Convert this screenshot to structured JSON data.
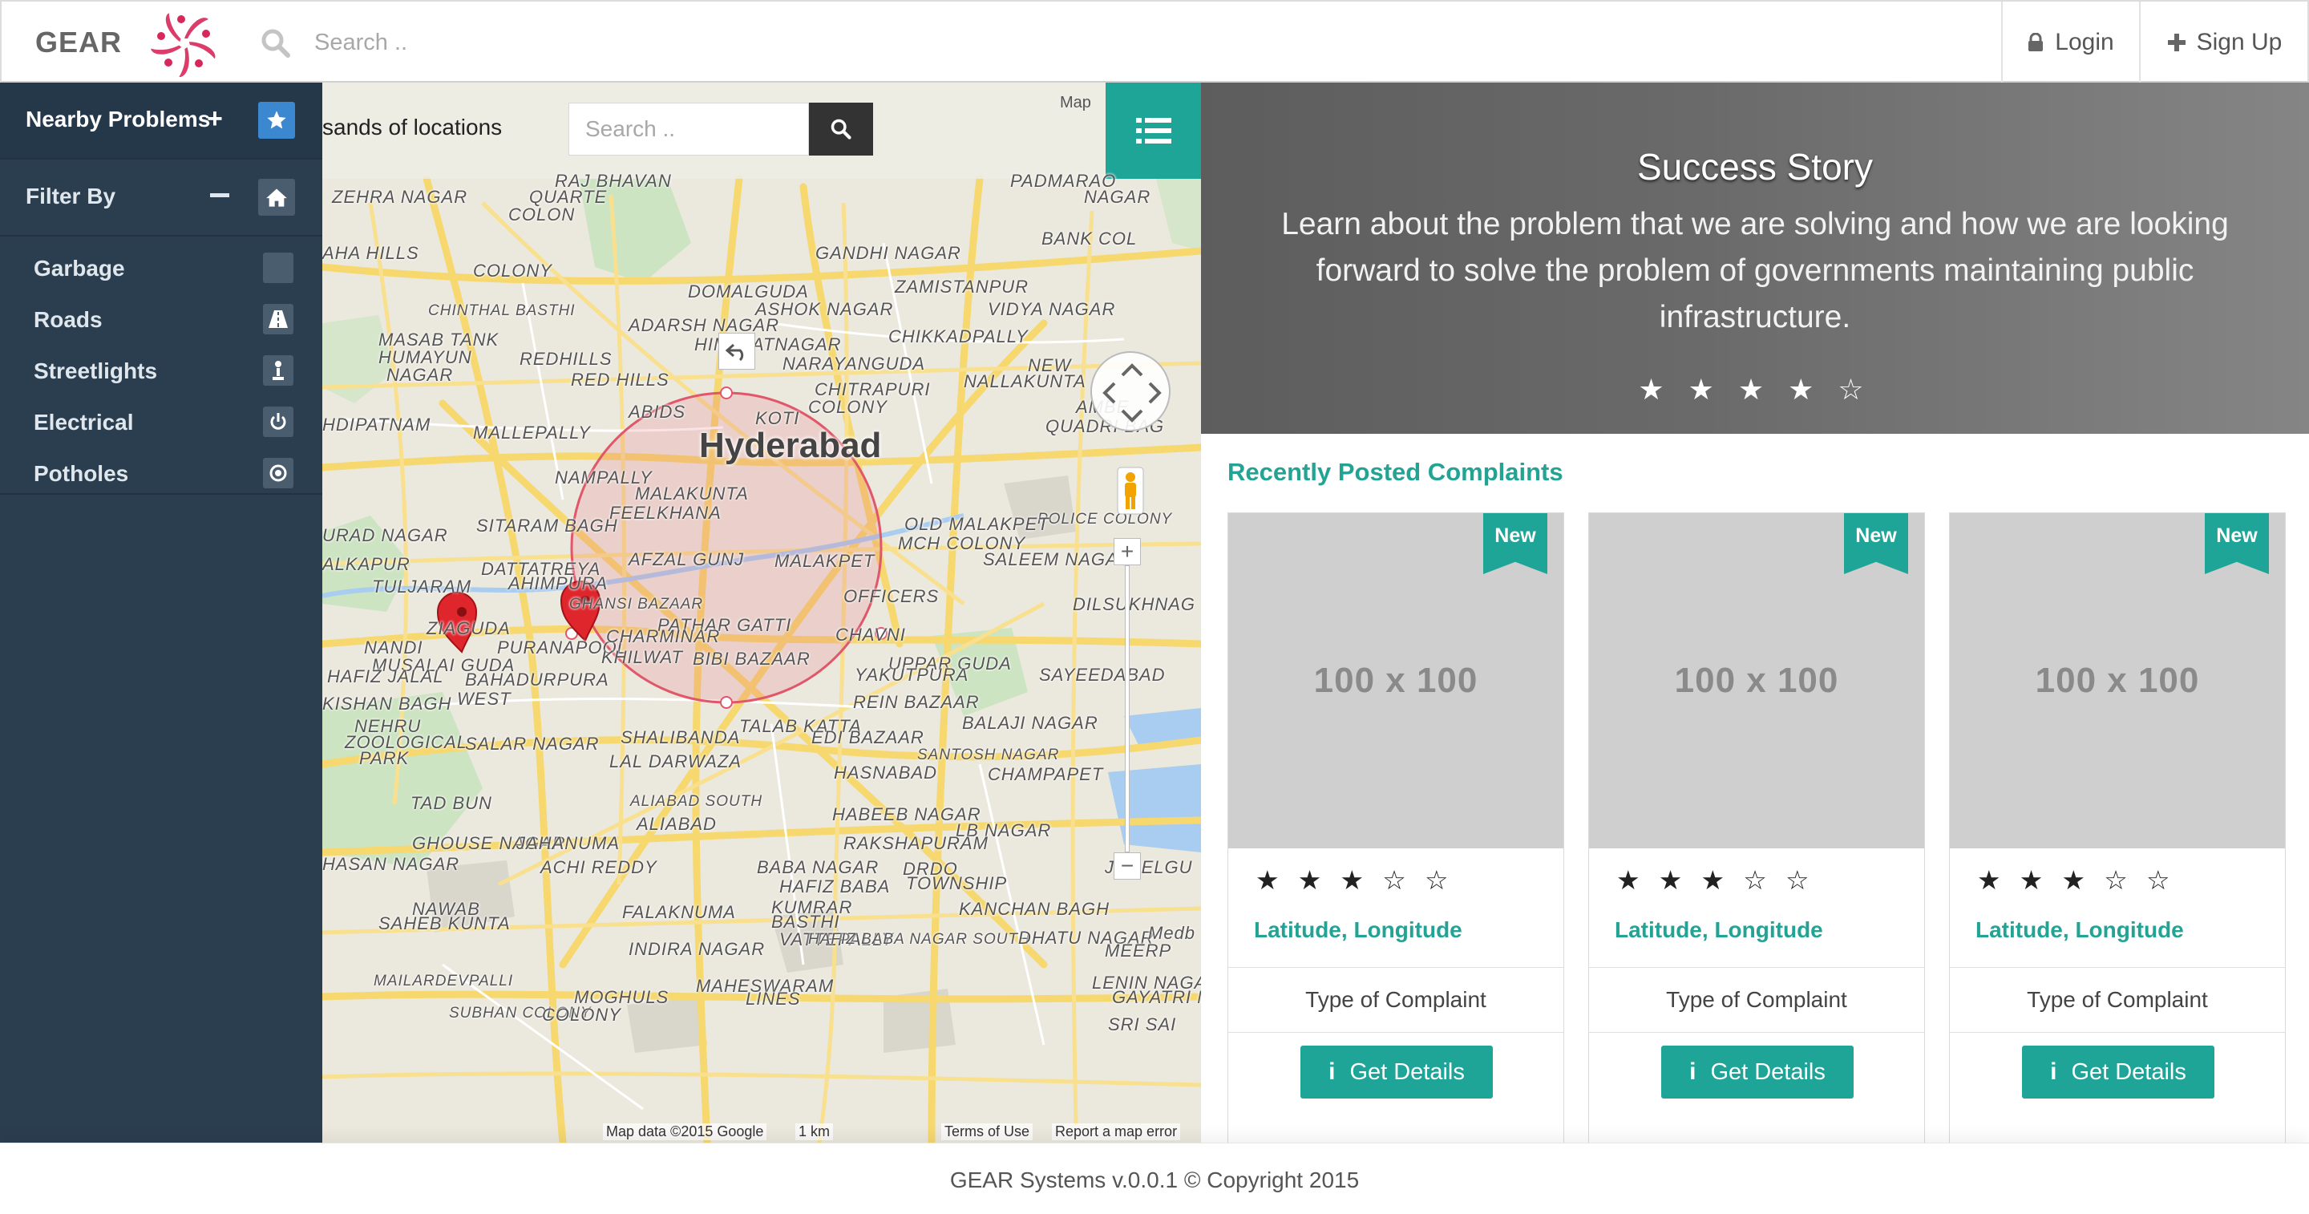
{
  "navbar": {
    "brand": "GEAR",
    "search_placeholder": "Search ..",
    "login_label": "Login",
    "signup_label": "Sign Up",
    "icons": {
      "search": "search-icon",
      "login": "lock-icon",
      "signup": "plus-icon"
    }
  },
  "sidebar": {
    "header_label": "Nearby Problems",
    "header_icon": "star-icon",
    "filter_label": "Filter By",
    "filter_icon": "home-icon",
    "items": [
      {
        "label": "Garbage",
        "icon": "square-icon"
      },
      {
        "label": "Roads",
        "icon": "road-icon"
      },
      {
        "label": "Streetlights",
        "icon": "streetlight-icon"
      },
      {
        "label": "Electrical",
        "icon": "power-icon"
      },
      {
        "label": "Potholes",
        "icon": "target-icon"
      }
    ]
  },
  "map": {
    "locations_text": "sands of locations",
    "search_placeholder": "Search ..",
    "map_type_label": "Map",
    "center_label": "Hyderabad",
    "labels": [
      "RAJ BHAVAN",
      "ZEHRA NAGAR",
      "QUARTE",
      "COLON",
      "PADMARAO",
      "NAGAR",
      "BANK COL",
      "GANDHI NAGAR",
      "AHA HILLS",
      "COLONY",
      "ZAMISTANPUR",
      "CHINTHAL BASTHI",
      "DOMALGUDA",
      "ASHOK NAGAR",
      "VIDYA NAGAR",
      "MASAB TANK",
      "ADARSH NAGAR",
      "HIMAYATNAGAR",
      "CHIKKADPALLY",
      "HUMAYUN",
      "NAGAR",
      "REDHILLS",
      "RED HILLS",
      "NARAYANGUDA",
      "NALLAKUNTA",
      "NEW",
      "KOTI",
      "CHITRAPURI",
      "COLONY",
      "ABIDS",
      "AMBE",
      "QUADRI BAG",
      "HDIPATNAM",
      "MALLEPALLY",
      "NAMPALLY",
      "POLICE COLONY",
      "MALAKUNTA",
      "SITARAM BAGH",
      "FEELKHANA",
      "OLD MALAKPET",
      "MCH COLONY",
      "URAD NAGAR",
      "DATTATREYA",
      "AFZAL GUNJ",
      "MALAKPET",
      "SALEEM NAGAR",
      "ALKAPUR",
      "TULJARAM",
      "AHIMPURA",
      "OFFICERS",
      "GHANSI BAZAAR",
      "PATHAR GATTI",
      "CHAVNI",
      "DILSUKHNAG",
      "ZIAGUDA",
      "NANDI",
      "MUSALAI GUDA",
      "PURANAPOOL",
      "CHARMINAR",
      "UPPAR GUDA",
      "HAFIZ JALAL",
      "BAHADURPURA",
      "KHILWAT",
      "BIBI BAZAAR",
      "YAKUTPURA",
      "SAYEEDABAD",
      "KISHAN BAGH",
      "WEST",
      "REIN BAZAAR",
      "TALAB KATTA",
      "BALAJI NAGAR",
      "NEHRU",
      "ZOOLOGICAL",
      "PARK",
      "SALAR NAGAR",
      "SHALIBANDA",
      "EDI BAZAAR",
      "SANTOSH NAGAR",
      "LAL DARWAZA",
      "HASNABAD",
      "CHAMPAPET",
      "TAD BUN",
      "ALIABAD SOUTH",
      "HABEEB NAGAR",
      "ALIABAD",
      "LB NAGAR",
      "GHOUSE NAGAR",
      "JAHANUMA",
      "RAKSHAPURAM",
      "HASAN NAGAR",
      "ACHI REDDY",
      "BABA NAGAR",
      "DRDO",
      "TOWNSHIP",
      "JILLELGU",
      "HAFIZ BABA",
      "NAWAB",
      "SAHEB KUNTA",
      "FALAKNUMA",
      "KUMRAR",
      "BASTHI",
      "KANCHAN BAGH",
      "VATTEPALLY",
      "INDIRA NAGAR",
      "HAFIZ BABA NAGAR SOUTH",
      "DHATU NAGAR",
      "MEERP",
      "MAILARDEVPALLI",
      "MAHESWARAM",
      "LINES",
      "LENIN NAGAR",
      "SUBHAN COLONY",
      "MOGHULS",
      "COLONY",
      "SRI SAI",
      "GAYATRI N",
      "Medb"
    ],
    "footer_data": "Map data ©2015 Google",
    "footer_scale": "1 km",
    "footer_terms": "Terms of Use",
    "footer_report": "Report a map error"
  },
  "hero": {
    "title": "Success Story",
    "text": "Learn about the problem that we are solving and how we are looking forward to solve the problem of governments maintaining public infrastructure.",
    "stars": "★ ★ ★ ★ ☆"
  },
  "complaints": {
    "title": "Recently Posted Complaints",
    "cards": [
      {
        "badge": "New",
        "image_text": "100 x 100",
        "stars": "★ ★ ★ ☆ ☆",
        "coords": "Latitude, Longitude",
        "type": "Type of Complaint",
        "button": "Get Details"
      },
      {
        "badge": "New",
        "image_text": "100 x 100",
        "stars": "★ ★ ★ ☆ ☆",
        "coords": "Latitude, Longitude",
        "type": "Type of Complaint",
        "button": "Get Details"
      },
      {
        "badge": "New",
        "image_text": "100 x 100",
        "stars": "★ ★ ★ ☆ ☆",
        "coords": "Latitude, Longitude",
        "type": "Type of Complaint",
        "button": "Get Details"
      }
    ]
  },
  "footer": {
    "text": "GEAR Systems v.0.0.1 © Copyright 2015"
  },
  "colors": {
    "accent": "#1ea598",
    "accent_text": "#23a394",
    "sidebar": "#2b3e50",
    "star_button": "#3b87d0",
    "circle": "#e0566b",
    "marker": "#e0262d"
  }
}
